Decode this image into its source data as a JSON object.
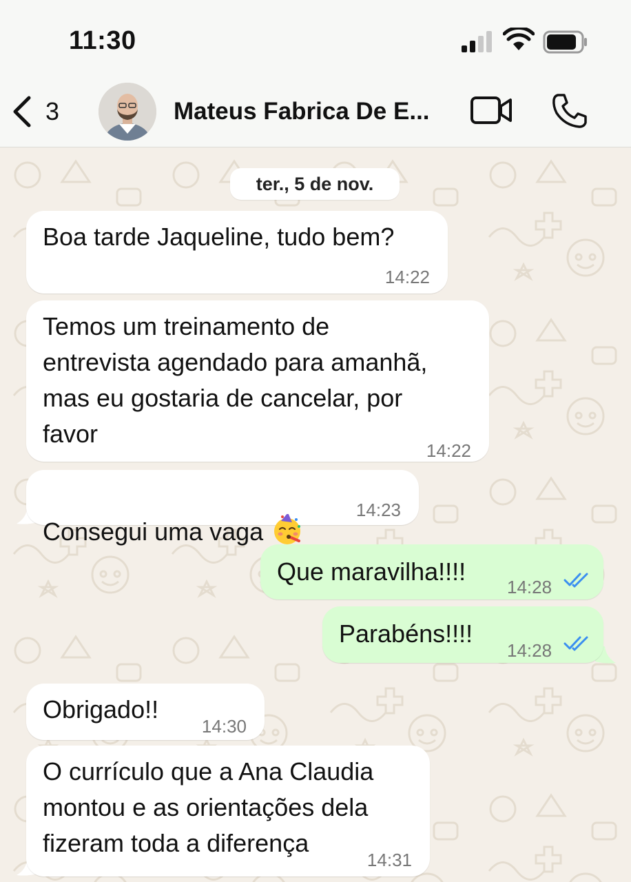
{
  "status_bar": {
    "time": "11:30"
  },
  "header": {
    "back_count": "3",
    "contact_name": "Mateus Fabrica De E..."
  },
  "chat": {
    "date_separator": "ter., 5 de nov.",
    "messages": [
      {
        "direction": "in",
        "text": "Boa tarde Jaqueline, tudo bem?",
        "time": "14:22"
      },
      {
        "direction": "in",
        "text": "Temos um treinamento de\nentrevista agendado para amanhã,\nmas eu gostaria de cancelar, por\nfavor",
        "time": "14:22"
      },
      {
        "direction": "in",
        "text": "Consegui uma vaga",
        "emoji": "partying-face-emoji",
        "time": "14:23"
      },
      {
        "direction": "out",
        "text": "Que maravilha!!!!",
        "time": "14:28",
        "status": "read"
      },
      {
        "direction": "out",
        "text": "Parabéns!!!!",
        "time": "14:28",
        "status": "read"
      },
      {
        "direction": "in",
        "text": "Obrigado!!",
        "time": "14:30"
      },
      {
        "direction": "in",
        "text": "O currículo que a Ana Claudia\nmontou e as orientações dela\nfizeram toda a diferença",
        "time": "14:31"
      }
    ]
  },
  "colors": {
    "incoming_bubble": "#ffffff",
    "outgoing_bubble": "#d9fdd3",
    "wallpaper": "#f4efe8",
    "read_ticks": "#3a8ef0"
  },
  "icons": [
    "back-chevron-icon",
    "video-call-icon",
    "phone-icon",
    "signal-icon",
    "wifi-icon",
    "battery-icon",
    "double-check-icon"
  ]
}
